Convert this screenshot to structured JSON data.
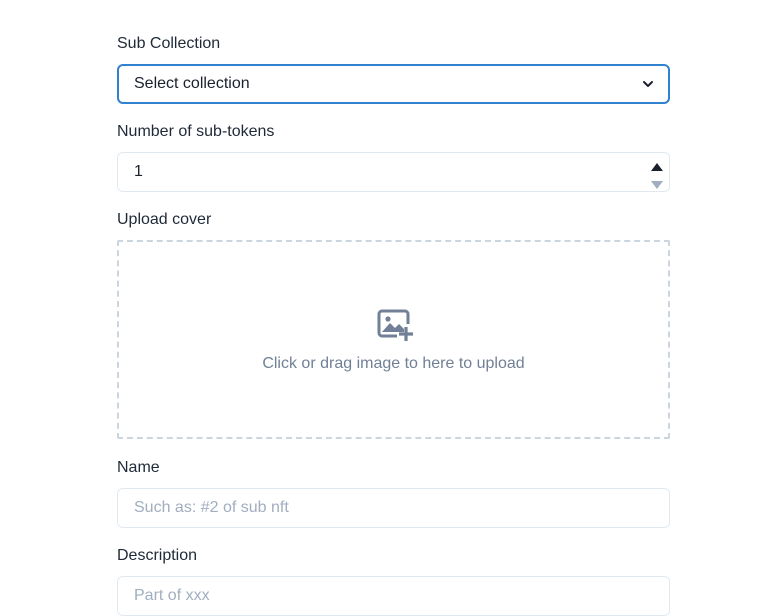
{
  "form": {
    "sub_collection": {
      "label": "Sub Collection",
      "selected_value": "Select collection",
      "icon": "chevron-down-icon"
    },
    "sub_tokens": {
      "label": "Number of sub-tokens",
      "value": "1"
    },
    "cover": {
      "label": "Upload cover",
      "hint": "Click or drag image to here to upload",
      "icon": "image-add-icon"
    },
    "name": {
      "label": "Name",
      "placeholder": "Such as: #2 of sub nft",
      "value": ""
    },
    "description": {
      "label": "Description",
      "placeholder": "Part of xxx",
      "value": ""
    }
  },
  "colors": {
    "focus_border": "#3182ce",
    "border": "#e2e8f0",
    "dashed_border": "#cbd5e0",
    "muted_text": "#718096",
    "placeholder": "#a0aec0"
  }
}
